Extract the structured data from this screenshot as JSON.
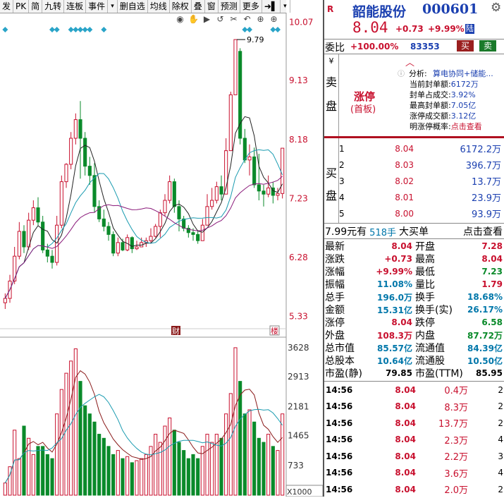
{
  "toolbar": {
    "items": [
      "发",
      "PK",
      "简",
      "九转",
      "连板",
      "事件",
      "▾",
      "删自选",
      "均线",
      "除权",
      "叠",
      "窗",
      "预测",
      "更多",
      "➜▌",
      "▾"
    ]
  },
  "chart_icons": [
    "eye-icon",
    "hand-icon",
    "play-icon",
    "undo-icon",
    "scissors-icon",
    "undo-icon",
    "add-icon",
    "add-icon"
  ],
  "main_chart": {
    "price_ticks": [
      "10.07",
      "9.13",
      "8.18",
      "7.23",
      "6.28",
      "5.33"
    ],
    "high_label": "9.79",
    "event_markers": [
      "财",
      "楼"
    ],
    "volume_ticks": [
      "3628",
      "2913",
      "2181",
      "1465",
      "733"
    ],
    "volume_unit": "X1000"
  },
  "chart_data": {
    "type": "candlestick",
    "candles": [
      [
        5.55,
        5.62,
        5.45,
        5.7
      ],
      [
        5.62,
        5.9,
        5.55,
        6.0
      ],
      [
        5.9,
        6.3,
        5.85,
        6.45
      ],
      [
        6.3,
        6.7,
        6.25,
        6.85
      ],
      [
        6.7,
        6.45,
        6.35,
        6.8
      ],
      [
        6.45,
        6.88,
        6.4,
        7.0
      ],
      [
        6.88,
        7.08,
        6.8,
        7.2
      ],
      [
        7.08,
        6.85,
        6.8,
        7.25
      ],
      [
        6.85,
        6.4,
        6.35,
        6.95
      ],
      [
        6.4,
        6.3,
        6.2,
        6.5
      ],
      [
        6.3,
        6.2,
        6.1,
        6.4
      ],
      [
        6.2,
        6.8,
        6.15,
        6.95
      ],
      [
        6.8,
        7.5,
        6.75,
        7.6
      ],
      [
        7.5,
        7.78,
        7.4,
        7.8
      ],
      [
        7.78,
        8.2,
        7.7,
        8.3
      ],
      [
        8.2,
        8.5,
        8.1,
        8.6
      ],
      [
        8.5,
        8.2,
        7.55,
        8.8
      ],
      [
        8.2,
        7.75,
        7.6,
        8.3
      ],
      [
        7.75,
        7.6,
        7.45,
        7.9
      ],
      [
        7.6,
        7.1,
        7.0,
        7.8
      ],
      [
        7.1,
        6.9,
        6.85,
        7.2
      ],
      [
        6.9,
        6.78,
        6.7,
        7.05
      ],
      [
        6.78,
        6.65,
        6.55,
        6.85
      ],
      [
        6.65,
        6.35,
        6.3,
        6.7
      ],
      [
        6.35,
        6.52,
        6.3,
        6.6
      ],
      [
        6.52,
        6.4,
        6.38,
        6.58
      ],
      [
        6.4,
        6.6,
        6.38,
        6.65
      ],
      [
        6.6,
        6.42,
        6.35,
        6.62
      ],
      [
        6.42,
        6.45,
        6.4,
        6.55
      ],
      [
        6.45,
        6.52,
        6.45,
        6.6
      ],
      [
        6.52,
        6.55,
        6.45,
        6.6
      ],
      [
        6.55,
        6.62,
        6.5,
        6.75
      ],
      [
        6.62,
        6.78,
        6.6,
        6.82
      ],
      [
        6.78,
        7.0,
        6.6,
        7.05
      ],
      [
        7.0,
        7.2,
        6.95,
        7.3
      ],
      [
        7.2,
        7.5,
        7.15,
        7.6
      ],
      [
        7.5,
        7.1,
        7.0,
        7.55
      ],
      [
        7.1,
        6.9,
        6.7,
        7.2
      ],
      [
        6.9,
        6.75,
        6.7,
        6.95
      ],
      [
        6.75,
        6.68,
        6.6,
        6.8
      ],
      [
        6.68,
        6.65,
        6.55,
        6.75
      ],
      [
        6.65,
        6.55,
        6.5,
        6.72
      ],
      [
        6.55,
        6.8,
        6.55,
        6.9
      ],
      [
        6.8,
        7.1,
        6.8,
        7.3
      ],
      [
        7.1,
        7.2,
        7.05,
        7.4
      ],
      [
        7.2,
        7.42,
        7.15,
        7.5
      ],
      [
        7.42,
        7.3,
        7.2,
        7.6
      ],
      [
        7.3,
        8.0,
        7.3,
        8.2
      ],
      [
        8.0,
        8.9,
        8.0,
        8.95
      ],
      [
        8.9,
        9.79,
        8.9,
        9.79
      ],
      [
        9.6,
        8.2,
        8.1,
        9.65
      ],
      [
        8.2,
        7.85,
        7.8,
        8.35
      ],
      [
        7.85,
        7.9,
        7.6,
        8.1
      ],
      [
        7.9,
        7.45,
        7.4,
        8.05
      ],
      [
        7.45,
        7.35,
        7.2,
        7.95
      ],
      [
        7.35,
        7.3,
        7.1,
        7.45
      ],
      [
        7.3,
        7.4,
        7.25,
        7.6
      ],
      [
        7.4,
        7.28,
        7.15,
        7.5
      ],
      [
        7.28,
        7.31,
        7.2,
        7.4
      ],
      [
        7.31,
        8.04,
        7.23,
        8.04
      ]
    ],
    "volumes": [
      300,
      700,
      1600,
      900,
      1700,
      1400,
      1000,
      1200,
      1200,
      1000,
      900,
      2000,
      2600,
      3000,
      3300,
      3600,
      2800,
      2200,
      2000,
      1800,
      1500,
      1400,
      1200,
      1000,
      1100,
      900,
      950,
      800,
      850,
      900,
      1000,
      1200,
      1500,
      1300,
      1700,
      1900,
      1600,
      1300,
      1100,
      900,
      1000,
      900,
      1200,
      1500,
      1300,
      1500,
      1400,
      2000,
      2500,
      3628,
      2800,
      2000,
      2100,
      1800,
      1400,
      1300,
      1500,
      1200,
      1100,
      2000
    ],
    "ylim_price": [
      5.2,
      10.2
    ],
    "ylim_volume": [
      0,
      3800
    ]
  },
  "quote": {
    "icon_letter": "R",
    "name": "韶能股份",
    "code": "000601",
    "price": "8.04",
    "change": "+0.73",
    "pct": "+9.99%",
    "tag": "陆",
    "weibi_label": "委比",
    "weibi_val": "+100.00%",
    "weicha_val": "83353",
    "buy_btn": "买",
    "sell_btn": "卖",
    "sell_side_labels": [
      "¥",
      "卖",
      "盘"
    ],
    "limit_title": "涨停",
    "limit_sub": "(首板)",
    "analysis_label": "分析:",
    "analysis_value": "算电协同+储能...",
    "limit_info": [
      {
        "k": "当前封单额:",
        "v": "6172万"
      },
      {
        "k": "封单占成交:",
        "v": "3.92%"
      },
      {
        "k": "最高封单额:",
        "v": "7.05亿"
      },
      {
        "k": "涨停成交额:",
        "v": "3.12亿"
      },
      {
        "k": "明涨停概率:",
        "v": "点击查看"
      }
    ],
    "buy_side_labels": [
      "买",
      "盘"
    ],
    "bids": [
      {
        "lvl": "1",
        "price": "8.04",
        "vol": "6172.2万"
      },
      {
        "lvl": "2",
        "price": "8.03",
        "vol": "396.7万"
      },
      {
        "lvl": "3",
        "price": "8.02",
        "vol": "13.7万"
      },
      {
        "lvl": "4",
        "price": "8.01",
        "vol": "23.9万"
      },
      {
        "lvl": "5",
        "price": "8.00",
        "vol": "93.9万"
      }
    ],
    "bigbuy": {
      "price": "7.99元有",
      "vol": "518手",
      "text": "大买单",
      "link": "点击查看"
    },
    "stats": [
      [
        "最新",
        "8.04",
        "开盘",
        "7.28"
      ],
      [
        "涨跌",
        "+0.73",
        "最高",
        "8.04"
      ],
      [
        "涨幅",
        "+9.99%",
        "最低",
        "7.23"
      ],
      [
        "振幅",
        "11.08%",
        "量比",
        "1.79"
      ],
      [
        "总手",
        "196.0万",
        "换手",
        "18.68%"
      ],
      [
        "金额",
        "15.31亿",
        "换手(实)",
        "26.17%"
      ],
      [
        "涨停",
        "8.04",
        "跌停",
        "6.58"
      ],
      [
        "外盘",
        "108.3万",
        "内盘",
        "87.72万"
      ],
      [
        "总市值",
        "85.57亿",
        "流通值",
        "84.39亿"
      ],
      [
        "总股本",
        "10.64亿",
        "流通股",
        "10.50亿"
      ],
      [
        "市盈(静)",
        "79.85",
        "市盈(TTM)",
        "85.95"
      ]
    ],
    "ticks": [
      {
        "time": "14:56",
        "price": "8.04",
        "vol": "0.4万",
        "n": "2"
      },
      {
        "time": "14:56",
        "price": "8.04",
        "vol": "8.3万",
        "n": "2"
      },
      {
        "time": "14:56",
        "price": "8.04",
        "vol": "13.7万",
        "n": "2"
      },
      {
        "time": "14:56",
        "price": "8.04",
        "vol": "2.3万",
        "n": "4"
      },
      {
        "time": "14:56",
        "price": "8.04",
        "vol": "2.2万",
        "n": "3"
      },
      {
        "time": "14:56",
        "price": "8.04",
        "vol": "3.6万",
        "n": "4"
      },
      {
        "time": "14:56",
        "price": "8.04",
        "vol": "2.0万",
        "n": "2"
      }
    ]
  },
  "colors": {
    "up": "#c8102e",
    "down": "#0a8a2a",
    "ma5": "#222222",
    "ma10": "#1a9bb0",
    "ma20": "#8a1a7a"
  }
}
